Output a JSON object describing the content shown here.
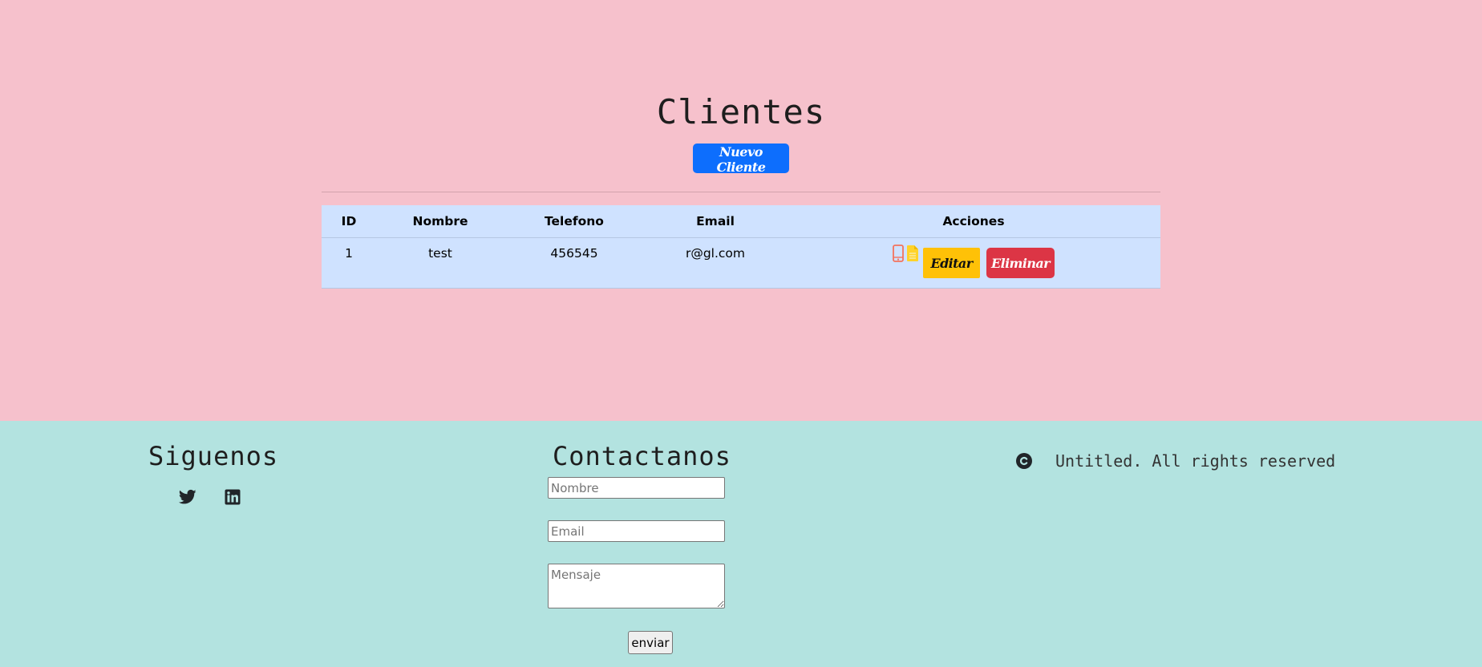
{
  "page": {
    "title": "Clientes",
    "new_client_label": "Nuevo Cliente"
  },
  "table": {
    "headers": {
      "id": "ID",
      "nombre": "Nombre",
      "telefono": "Telefono",
      "email": "Email",
      "acciones": "Acciones"
    },
    "rows": [
      {
        "id": "1",
        "nombre": "test",
        "telefono": "456545",
        "email": "r@gl.com",
        "edit_label": "Editar",
        "delete_label": "Eliminar"
      }
    ]
  },
  "footer": {
    "follow_title": "Siguenos",
    "social": [
      "twitter-icon",
      "linkedin-icon"
    ],
    "contact_title": "Contactanos",
    "form": {
      "name_placeholder": "Nombre",
      "email_placeholder": "Email",
      "message_placeholder": "Mensaje",
      "submit_label": "enviar"
    },
    "copyright_text": "Untitled. All rights reserved"
  },
  "colors": {
    "main_bg": "#f6c1cc",
    "footer_bg": "#b3e3e0",
    "table_bg": "#cfe2ff",
    "primary": "#0d6efd",
    "warning": "#ffc107",
    "danger": "#dc3545",
    "phone_icon": "#f4735d",
    "doc_icon": "#ffd32a"
  }
}
